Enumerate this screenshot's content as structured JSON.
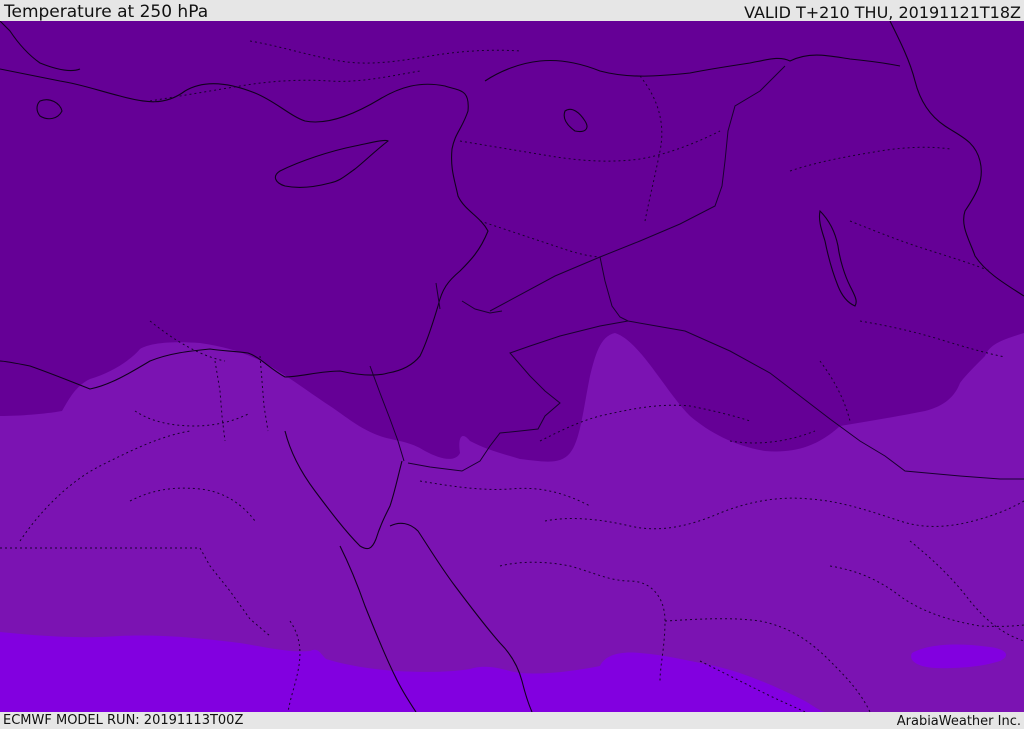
{
  "header": {
    "title": "Temperature at 250 hPa",
    "valid": "VALID T+210 THU, 20191121T18Z"
  },
  "footer": {
    "model_run": "ECMWF MODEL RUN: 20191113T00Z",
    "credit": "ArabiaWeather Inc."
  },
  "colors": {
    "dark_band": "#650096",
    "mid_band": "#7b13b2",
    "light_band": "#8200e0",
    "boundary_line": "#1a0030",
    "bar_background": "#e6e6e6"
  }
}
